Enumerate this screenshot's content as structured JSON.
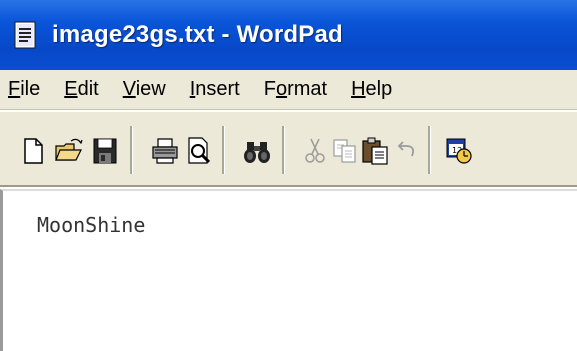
{
  "window": {
    "title": "image23gs.txt - WordPad"
  },
  "menubar": {
    "items": [
      {
        "mnemonic": "F",
        "rest": "ile"
      },
      {
        "mnemonic": "E",
        "rest": "dit"
      },
      {
        "mnemonic": "V",
        "rest": "iew"
      },
      {
        "mnemonic": "I",
        "rest": "nsert"
      },
      {
        "pre": "F",
        "mnemonic": "o",
        "rest": "rmat"
      },
      {
        "mnemonic": "H",
        "rest": "elp"
      }
    ]
  },
  "toolbar": {
    "buttons": [
      "new-icon",
      "open-icon",
      "save-icon",
      "print-icon",
      "print-preview-icon",
      "find-icon",
      "cut-icon",
      "copy-icon",
      "paste-icon",
      "undo-icon",
      "date-time-icon"
    ]
  },
  "document": {
    "text": "MoonShine"
  },
  "colors": {
    "titlebar": "#0a55d9",
    "chrome": "#ece9d8"
  }
}
